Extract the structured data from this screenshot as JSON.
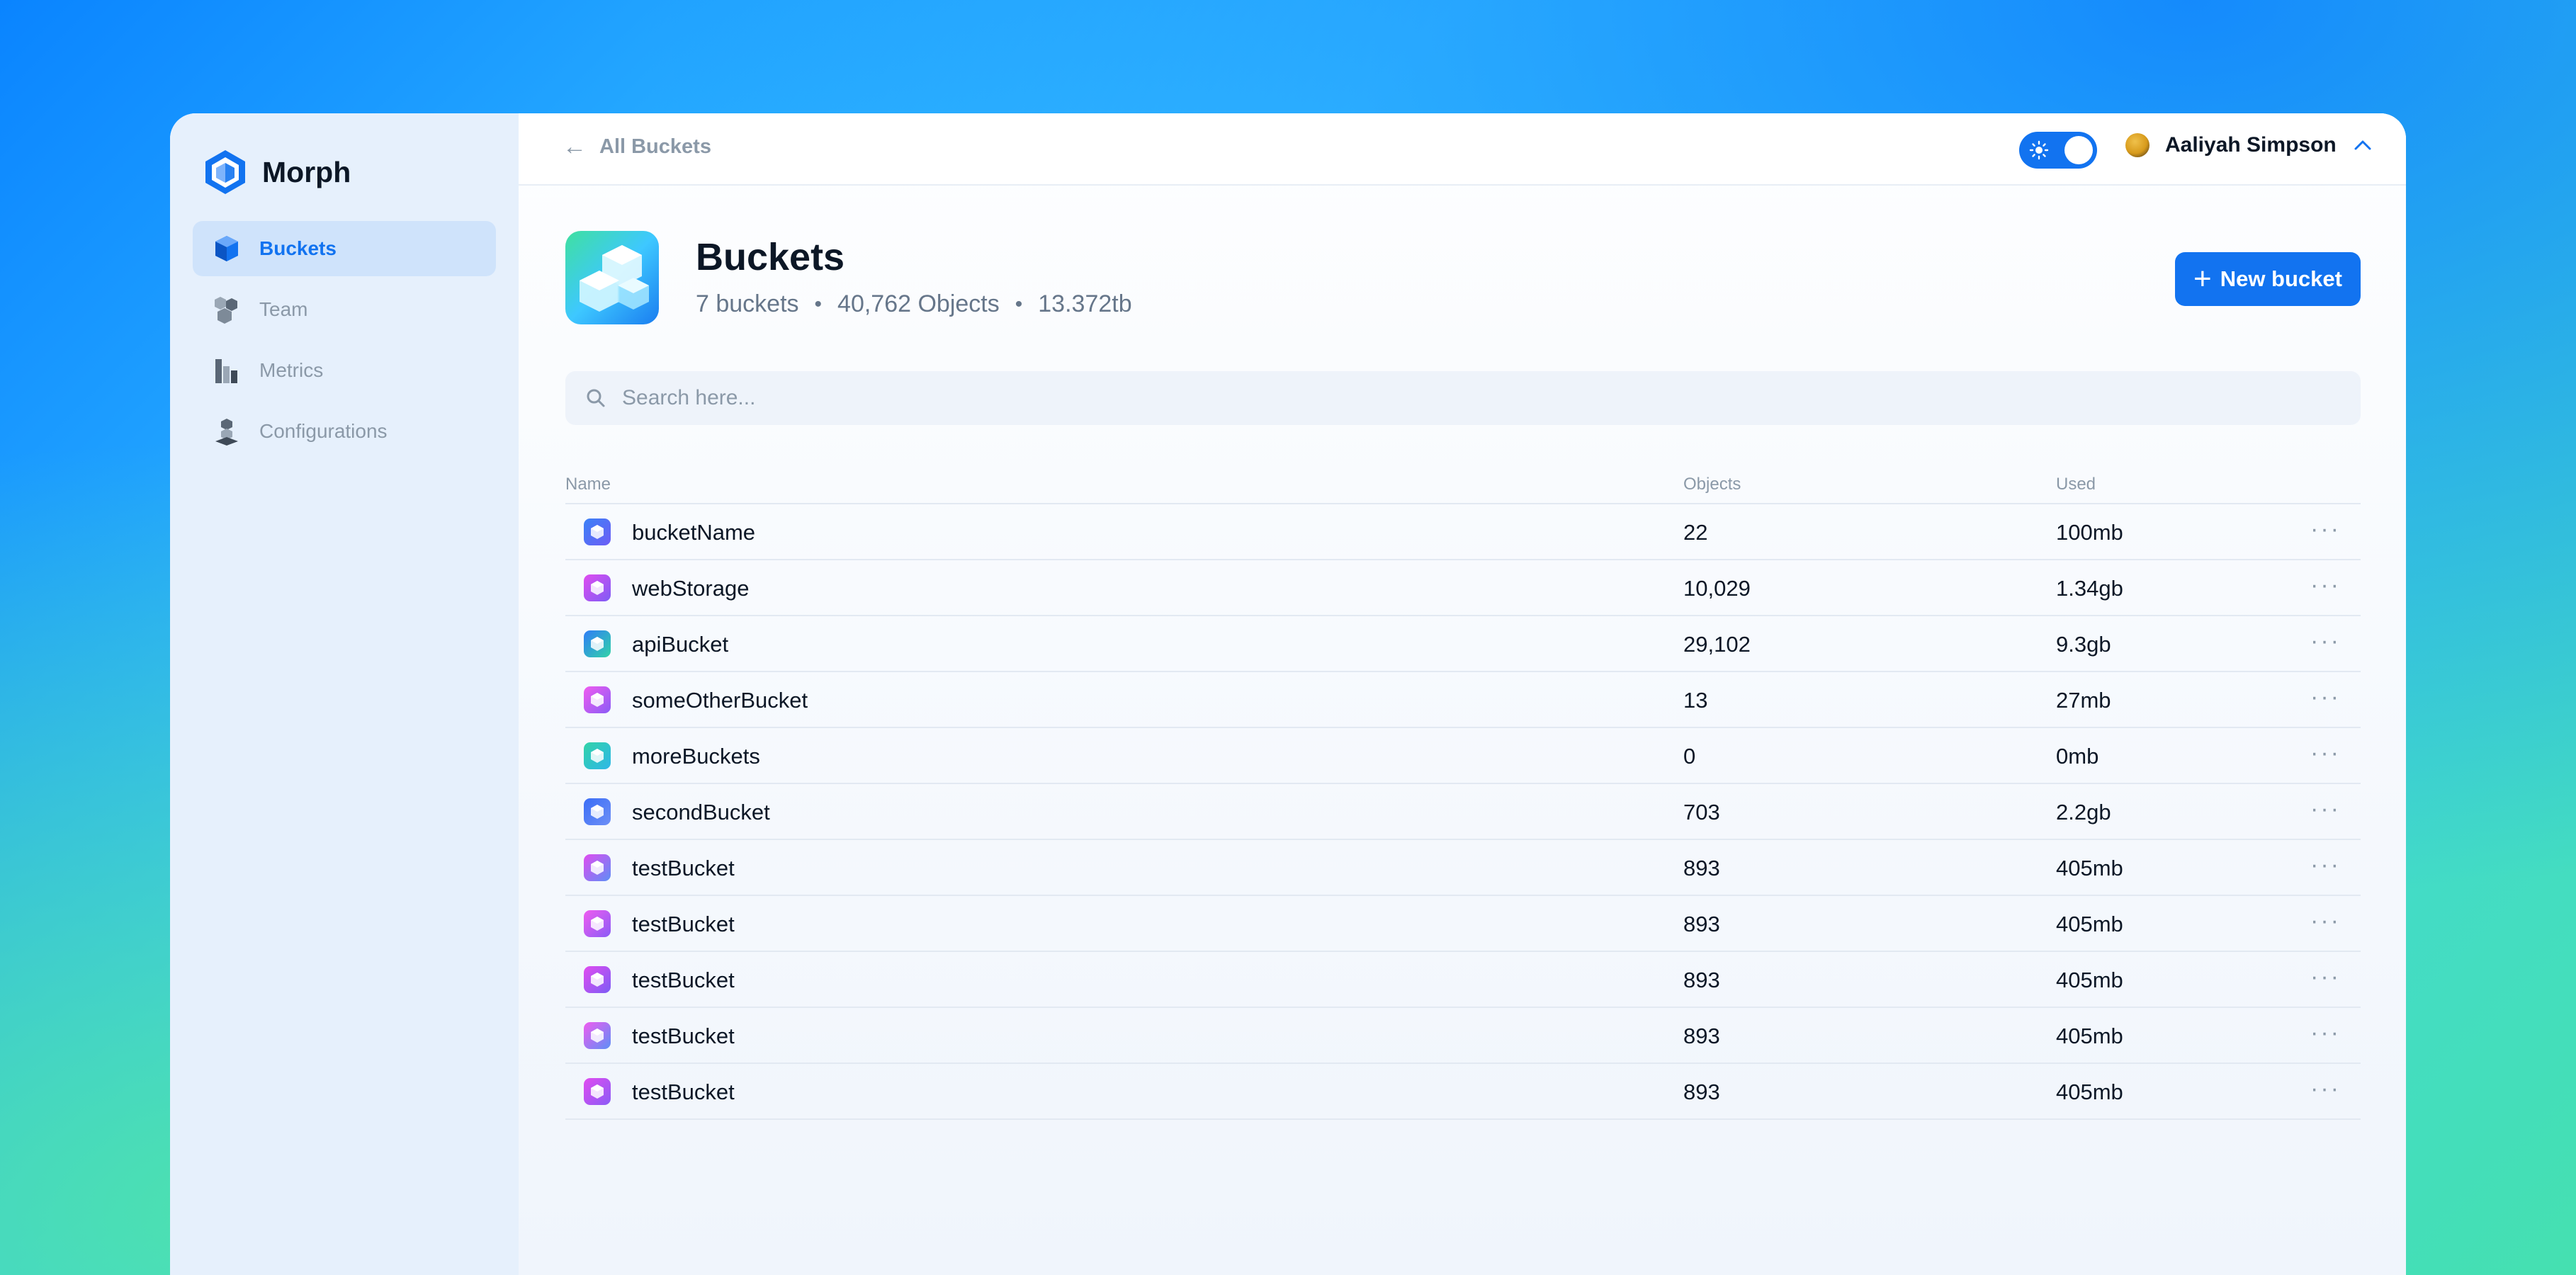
{
  "brand": {
    "name": "Morph",
    "icon": "hexagon-shield-icon",
    "color": "#1273f0"
  },
  "sidebar": {
    "items": [
      {
        "label": "Buckets",
        "icon": "bucket-cube-icon",
        "active": true
      },
      {
        "label": "Team",
        "icon": "team-cubes-icon",
        "active": false
      },
      {
        "label": "Metrics",
        "icon": "metrics-bars-icon",
        "active": false
      },
      {
        "label": "Configurations",
        "icon": "config-stack-icon",
        "active": false
      }
    ]
  },
  "topbar": {
    "back_label": "All Buckets",
    "user_name": "Aaliyah Simpson",
    "theme_toggle": "light"
  },
  "header": {
    "title": "Buckets",
    "bucket_count": "7 buckets",
    "objects_count": "40,762 Objects",
    "total_size": "13.372tb",
    "new_button_label": "New bucket"
  },
  "search": {
    "placeholder": "Search here..."
  },
  "table": {
    "columns": {
      "name": "Name",
      "objects": "Objects",
      "used": "Used"
    },
    "rows": [
      {
        "name": "bucketName",
        "objects": "22",
        "used": "100mb",
        "icon_colors": [
          "#3b82f6",
          "#6d5df6"
        ]
      },
      {
        "name": "webStorage",
        "objects": "10,029",
        "used": "1.34gb",
        "icon_colors": [
          "#e14cf0",
          "#7c5cf5"
        ]
      },
      {
        "name": "apiBucket",
        "objects": "29,102",
        "used": "9.3gb",
        "icon_colors": [
          "#2f7df6",
          "#32d3a8"
        ]
      },
      {
        "name": "someOtherBucket",
        "objects": "13",
        "used": "27mb",
        "icon_colors": [
          "#f05cf0",
          "#8a5cf6"
        ]
      },
      {
        "name": "moreBuckets",
        "objects": "0",
        "used": "0mb",
        "icon_colors": [
          "#32d3a8",
          "#2fb7e8"
        ]
      },
      {
        "name": "secondBucket",
        "objects": "703",
        "used": "2.2gb",
        "icon_colors": [
          "#3b6ef6",
          "#6d8ff6"
        ]
      },
      {
        "name": "testBucket",
        "objects": "893",
        "used": "405mb",
        "icon_colors": [
          "#e14cf0",
          "#5c8ff6"
        ]
      },
      {
        "name": "testBucket",
        "objects": "893",
        "used": "405mb",
        "icon_colors": [
          "#f05cf0",
          "#8a5cf6"
        ]
      },
      {
        "name": "testBucket",
        "objects": "893",
        "used": "405mb",
        "icon_colors": [
          "#e14cf0",
          "#7c5cf5"
        ]
      },
      {
        "name": "testBucket",
        "objects": "893",
        "used": "405mb",
        "icon_colors": [
          "#f05cf0",
          "#5c8ff6"
        ]
      },
      {
        "name": "testBucket",
        "objects": "893",
        "used": "405mb",
        "icon_colors": [
          "#e14cf0",
          "#8a5cf6"
        ]
      }
    ]
  }
}
